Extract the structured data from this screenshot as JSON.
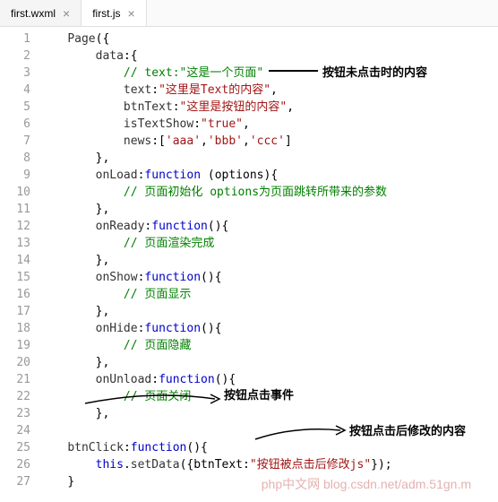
{
  "tabs": [
    {
      "label": "first.wxml",
      "active": false
    },
    {
      "label": "first.js",
      "active": true
    }
  ],
  "code": {
    "l1": {
      "pre": "    ",
      "fn": "Page",
      "t1": "({"
    },
    "l2": {
      "pre": "        ",
      "id": "data",
      "t1": ":{"
    },
    "l3": {
      "pre": "            ",
      "cm": "// text:\"这是一个页面\""
    },
    "l4": {
      "pre": "            ",
      "id": "text",
      "t1": ":",
      "str": "\"这里是Text的内容\"",
      "t2": ","
    },
    "l5": {
      "pre": "            ",
      "id": "btnText",
      "t1": ":",
      "str": "\"这里是按钮的内容\"",
      "t2": ","
    },
    "l6": {
      "pre": "            ",
      "id": "isTextShow",
      "t1": ":",
      "str": "\"true\"",
      "t2": ","
    },
    "l7": {
      "pre": "            ",
      "id": "news",
      "t1": ":[",
      "s1": "'aaa'",
      "c1": ",",
      "s2": "'bbb'",
      "c2": ",",
      "s3": "'ccc'",
      "t2": "]"
    },
    "l8": {
      "pre": "        ",
      "t1": "},"
    },
    "l9": {
      "pre": "        ",
      "id": "onLoad",
      "t1": ":",
      "kw": "function",
      "t2": " (options){"
    },
    "l10": {
      "pre": "            ",
      "cm": "// 页面初始化 options为页面跳转所带来的参数"
    },
    "l11": {
      "pre": "        ",
      "t1": "},"
    },
    "l12": {
      "pre": "        ",
      "id": "onReady",
      "t1": ":",
      "kw": "function",
      "t2": "(){"
    },
    "l13": {
      "pre": "            ",
      "cm": "// 页面渲染完成"
    },
    "l14": {
      "pre": "        ",
      "t1": "},"
    },
    "l15": {
      "pre": "        ",
      "id": "onShow",
      "t1": ":",
      "kw": "function",
      "t2": "(){"
    },
    "l16": {
      "pre": "            ",
      "cm": "// 页面显示"
    },
    "l17": {
      "pre": "        ",
      "t1": "},"
    },
    "l18": {
      "pre": "        ",
      "id": "onHide",
      "t1": ":",
      "kw": "function",
      "t2": "(){"
    },
    "l19": {
      "pre": "            ",
      "cm": "// 页面隐藏"
    },
    "l20": {
      "pre": "        ",
      "t1": "},"
    },
    "l21": {
      "pre": "        ",
      "id": "onUnload",
      "t1": ":",
      "kw": "function",
      "t2": "(){"
    },
    "l22": {
      "pre": "            ",
      "cm": "// 页面关闭"
    },
    "l23": {
      "pre": "        ",
      "t1": "},"
    },
    "l24": {
      "pre": ""
    },
    "l25": {
      "pre": "    ",
      "id": "btnClick",
      "t1": ":",
      "kw": "function",
      "t2": "(){"
    },
    "l26": {
      "pre": "        ",
      "kw": "this",
      "t1": ".",
      "fn": "setData",
      "t2": "({btnText:",
      "str": "\"按钮被点击后修改js\"",
      "t3": "});"
    },
    "l27": {
      "pre": "    ",
      "t1": "}"
    }
  },
  "annotations": {
    "a1": "按钮未点击时的内容",
    "a2": "按钮点击事件",
    "a3": "按钮点击后修改的内容"
  },
  "watermark": "php中文网\nblog.csdn.net/adm.51gn.m"
}
